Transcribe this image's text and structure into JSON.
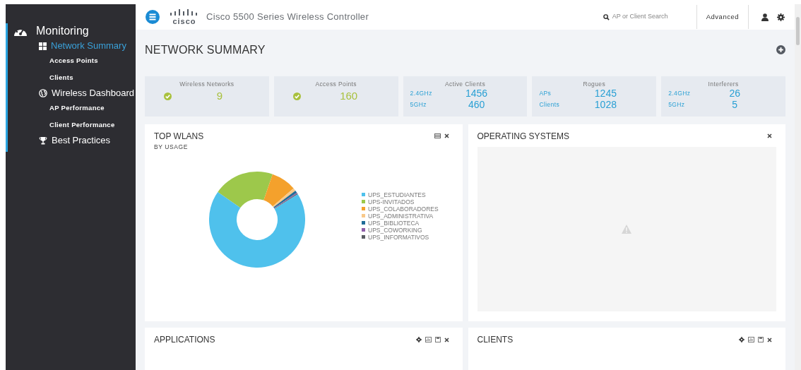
{
  "sidebar": {
    "sections": [
      {
        "label": "Monitoring",
        "children": [
          {
            "label": "Network Summary",
            "selected": true,
            "children": [
              {
                "label": "Access Points",
                "selected": false
              },
              {
                "label": "Clients",
                "selected": false
              }
            ]
          },
          {
            "label": "Wireless Dashboard",
            "selected": false,
            "children": [
              {
                "label": "AP Performance",
                "selected": false
              },
              {
                "label": "Client Performance",
                "selected": false
              }
            ]
          },
          {
            "label": "Best Practices",
            "selected": false
          }
        ]
      }
    ]
  },
  "header": {
    "logo": "cisco",
    "brand": "Cisco 5500 Series Wireless Controller",
    "search": {
      "placeholder": "AP or Client Search"
    },
    "advanced": "Advanced"
  },
  "page_title": "NETWORK SUMMARY",
  "tiles": [
    {
      "title": "Wireless Networks",
      "kind": "status",
      "value": "9"
    },
    {
      "title": "Access Points",
      "kind": "status",
      "value": "160"
    },
    {
      "title": "Active Clients",
      "kind": "split",
      "rows": [
        {
          "label": "2.4GHz",
          "value": "1456"
        },
        {
          "label": "5GHz",
          "value": "460"
        }
      ]
    },
    {
      "title": "Rogues",
      "kind": "split",
      "rows": [
        {
          "label": "APs",
          "value": "1245"
        },
        {
          "label": "Clients",
          "value": "1028"
        }
      ]
    },
    {
      "title": "Interferers",
      "kind": "split",
      "rows": [
        {
          "label": "2.4GHz",
          "value": "26"
        },
        {
          "label": "5GHz",
          "value": "5"
        }
      ]
    }
  ],
  "panels": [
    {
      "title": "TOP WLANS",
      "subtitle": "BY USAGE",
      "kind": "donut",
      "legend": [
        {
          "label": "UPS_ESTUDIANTES",
          "color": "#4fc1ec"
        },
        {
          "label": "UPS-INVITADOS",
          "color": "#9dc84b"
        },
        {
          "label": "UPS_COLABORADORES",
          "color": "#f4a12c"
        },
        {
          "label": "UPS_ADMINISTRATIVA",
          "color": "#f8c98a"
        },
        {
          "label": "UPS_BIBLIOTECA",
          "color": "#1f6c98"
        },
        {
          "label": "UPS_COWORKING",
          "color": "#8e5ea8"
        },
        {
          "label": "UPS_INFORMATIVOS",
          "color": "#5a5d63"
        }
      ]
    },
    {
      "title": "OPERATING SYSTEMS",
      "kind": "empty"
    },
    {
      "title": "APPLICATIONS",
      "kind": "cut"
    },
    {
      "title": "CLIENTS",
      "kind": "cut"
    }
  ]
}
